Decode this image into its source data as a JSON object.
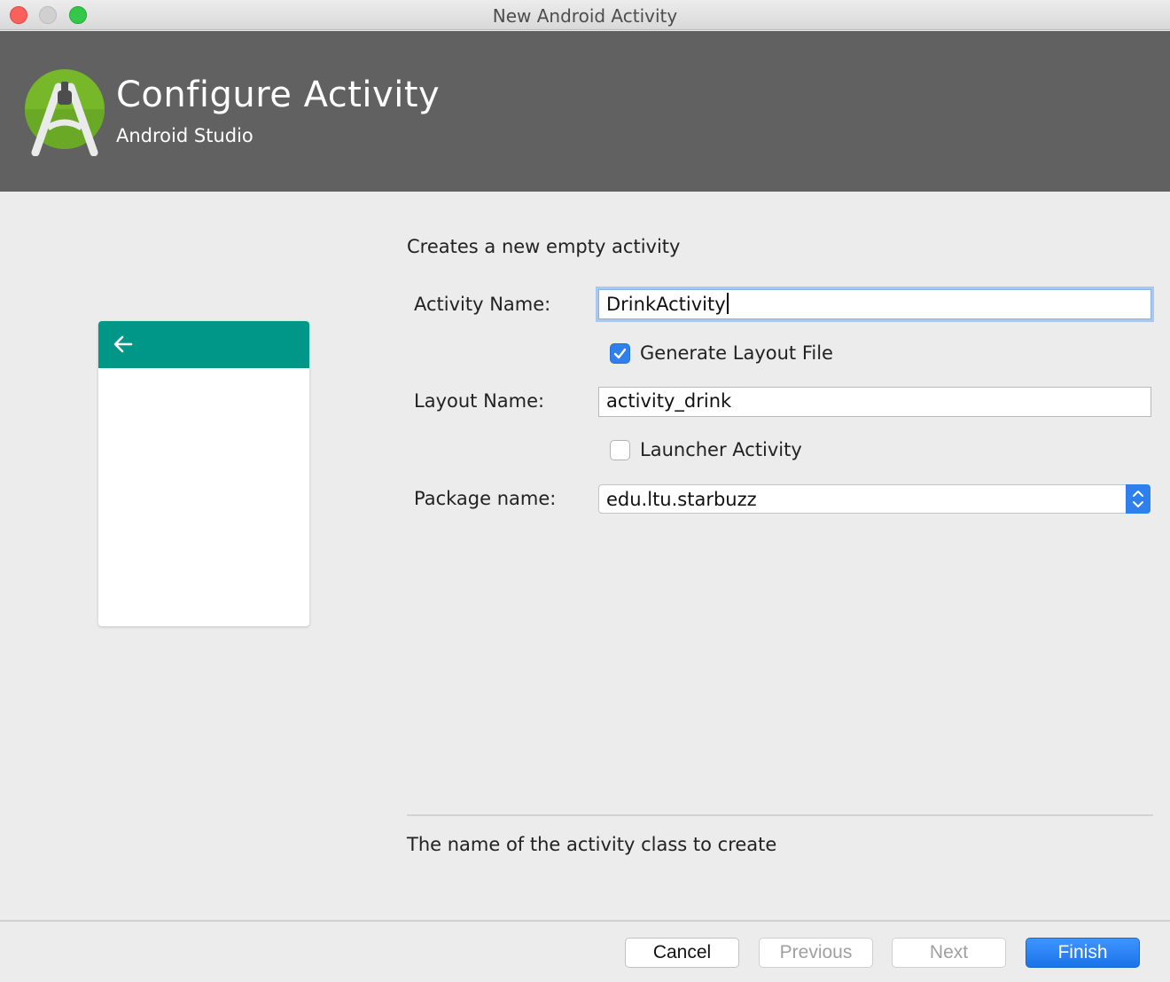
{
  "window": {
    "title": "New Android Activity"
  },
  "header": {
    "title": "Configure Activity",
    "subtitle": "Android Studio"
  },
  "main": {
    "description": "Creates a new empty activity",
    "activity_name": {
      "label": "Activity Name:",
      "value": "DrinkActivity"
    },
    "generate_layout": {
      "label": "Generate Layout File",
      "checked": true
    },
    "layout_name": {
      "label": "Layout Name:",
      "value": "activity_drink"
    },
    "launcher_activity": {
      "label": "Launcher Activity",
      "checked": false
    },
    "package_name": {
      "label": "Package name:",
      "value": "edu.ltu.starbuzz"
    },
    "hint": "The name of the activity class to create"
  },
  "footer": {
    "cancel": "Cancel",
    "previous": "Previous",
    "next": "Next",
    "finish": "Finish"
  },
  "colors": {
    "banner": "#616161",
    "preview_toolbar": "#009688",
    "accent": "#2f80ed"
  }
}
